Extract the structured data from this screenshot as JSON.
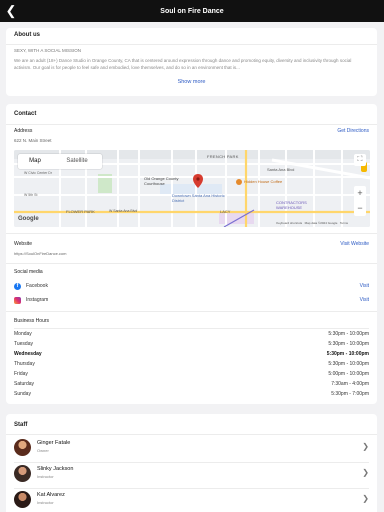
{
  "header": {
    "title": "Soul on Fire Dance"
  },
  "about": {
    "heading": "About us",
    "tagline": "SEXY, WITH A SOCIAL MISSION",
    "body": "We are an adult (18+) Dance Studio in Orange County, CA that is centered around expression through dance and promoting equity, diversity and inclusivity through social activism. Our goal is for people to feel safe and embodied, love themselves, and do so in an environment that is...",
    "show_more": "Show more"
  },
  "contact": {
    "heading": "Contact",
    "address_label": "Address",
    "address_value": "622 N. Main Street",
    "directions": "Get Directions",
    "map": {
      "tab_map": "Map",
      "tab_satellite": "Satellite",
      "labels": {
        "french_park": "FRENCH PARK",
        "santa_ana_blvd": "Santa Ana Blvd",
        "hidden_house": "Hidden House Coffee",
        "old_courthouse": "Old Orange County Courthouse",
        "downtown": "Downtown Santa Ana Historic District",
        "contractors": "CONTRACTORS WAREHOUSE",
        "civic_center": "W Civic Center Dr",
        "flower_park": "FLOWER PARK",
        "w_santa_ana": "W Santa Ana Blvd",
        "lacy": "LACY",
        "fifth_st": "W 5th St",
        "google": "Google",
        "attribution": "Keyboard shortcuts   Map data ©2024 Google   Terms"
      },
      "zoom_in": "+",
      "zoom_out": "−"
    },
    "website_label": "Website",
    "website_value": "https://SoulOnFireDance.com",
    "visit_website": "Visit Website"
  },
  "social": {
    "heading": "Social media",
    "items": [
      {
        "name": "Facebook",
        "action": "Visit"
      },
      {
        "name": "Instagram",
        "action": "Visit"
      }
    ]
  },
  "hours": {
    "heading": "Business Hours",
    "rows": [
      {
        "day": "Monday",
        "time": "5:30pm - 10:00pm"
      },
      {
        "day": "Tuesday",
        "time": "5:30pm - 10:00pm"
      },
      {
        "day": "Wednesday",
        "time": "5:30pm - 10:00pm"
      },
      {
        "day": "Thursday",
        "time": "5:30pm - 10:00pm"
      },
      {
        "day": "Friday",
        "time": "5:00pm - 10:00pm"
      },
      {
        "day": "Saturday",
        "time": "7:30am - 4:00pm"
      },
      {
        "day": "Sunday",
        "time": "5:30pm - 7:00pm"
      }
    ]
  },
  "staff": {
    "heading": "Staff",
    "members": [
      {
        "name": "Ginger Fatale",
        "role": "Owner"
      },
      {
        "name": "Slinky Jackson",
        "role": "Instructor"
      },
      {
        "name": "Kat Alvarez",
        "role": "Instructor"
      }
    ]
  },
  "colors": {
    "accent": "#2b59c3",
    "topbar": "#111111",
    "pin": "#d63b2f"
  }
}
